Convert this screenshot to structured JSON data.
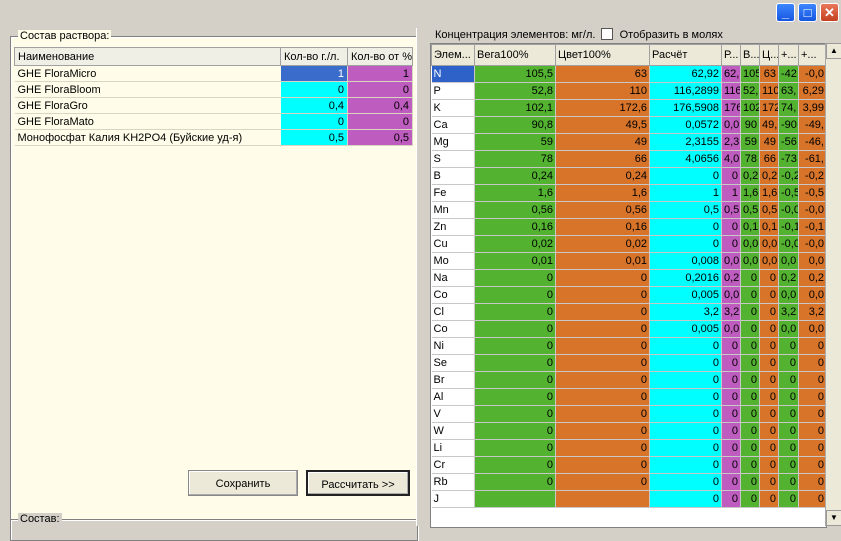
{
  "window": {
    "buttons": {
      "minimize": "_",
      "maximize": "□",
      "close": "✕"
    }
  },
  "left": {
    "group_title": "Состав раствора:",
    "bottom_group_title": "Состав:",
    "columns": [
      "Наименование",
      "Кол-во г./л.",
      "Кол-во от %"
    ],
    "rows": [
      {
        "name": "GHE FloraMicro",
        "qty": "1",
        "pct": "1"
      },
      {
        "name": "GHE FloraBloom",
        "qty": "0",
        "pct": "0"
      },
      {
        "name": "GHE FloraGro",
        "qty": "0,4",
        "pct": "0,4"
      },
      {
        "name": "GHE FloraMato",
        "qty": "0",
        "pct": "0"
      },
      {
        "name": "Монофосфат Калия KH2PO4 (Буйские уд-я)",
        "qty": "0,5",
        "pct": "0,5"
      }
    ],
    "save_label": "Сохранить",
    "calc_label": "Рассчитать >>"
  },
  "right": {
    "label": "Концентрация элементов: мг/л.",
    "checkbox_label": "Отобразить в молях",
    "columns": [
      "Элем...",
      "Вега100%",
      "Цвет100%",
      "Расчёт",
      "Р...",
      "В...",
      "Ц...",
      "+...",
      "+..."
    ],
    "rows": [
      [
        "N",
        "105,5",
        "63",
        "62,92",
        "62,",
        "105",
        "63",
        "-42",
        "-0,0"
      ],
      [
        "P",
        "52,8",
        "110",
        "116,2899",
        "116",
        "52,",
        "110",
        "63,",
        "6,29"
      ],
      [
        "K",
        "102,1",
        "172,6",
        "176,5908",
        "176",
        "102",
        "172",
        "74,",
        "3,99"
      ],
      [
        "Ca",
        "90,8",
        "49,5",
        "0,0572",
        "0,0",
        "90",
        "49,",
        "-90",
        "-49,"
      ],
      [
        "Mg",
        "59",
        "49",
        "2,3155",
        "2,3",
        "59",
        "49",
        "-56",
        "-46,"
      ],
      [
        "S",
        "78",
        "66",
        "4,0656",
        "4,0",
        "78",
        "66",
        "-73",
        "-61,"
      ],
      [
        "B",
        "0,24",
        "0,24",
        "0",
        "0",
        "0,2",
        "0,2",
        "-0,2",
        "-0,2"
      ],
      [
        "Fe",
        "1,6",
        "1,6",
        "1",
        "1",
        "1,6",
        "1,6",
        "-0,5",
        "-0,5"
      ],
      [
        "Mn",
        "0,56",
        "0,56",
        "0,5",
        "0,5",
        "0,5",
        "0,5",
        "-0,0",
        "-0,0"
      ],
      [
        "Zn",
        "0,16",
        "0,16",
        "0",
        "0",
        "0,1",
        "0,1",
        "-0,1",
        "-0,1"
      ],
      [
        "Cu",
        "0,02",
        "0,02",
        "0",
        "0",
        "0,0",
        "0,0",
        "-0,0",
        "-0,0"
      ],
      [
        "Mo",
        "0,01",
        "0,01",
        "0,008",
        "0,0",
        "0,0",
        "0,0",
        "0,0",
        "0,0"
      ],
      [
        "Na",
        "0",
        "0",
        "0,2016",
        "0,2",
        "0",
        "0",
        "0,2",
        "0,2"
      ],
      [
        "Co",
        "0",
        "0",
        "0,005",
        "0,0",
        "0",
        "0",
        "0,0",
        "0,0"
      ],
      [
        "Cl",
        "0",
        "0",
        "3,2",
        "3,2",
        "0",
        "0",
        "3,2",
        "3,2"
      ],
      [
        "Co",
        "0",
        "0",
        "0,005",
        "0,0",
        "0",
        "0",
        "0,0",
        "0,0"
      ],
      [
        "Ni",
        "0",
        "0",
        "0",
        "0",
        "0",
        "0",
        "0",
        "0"
      ],
      [
        "Se",
        "0",
        "0",
        "0",
        "0",
        "0",
        "0",
        "0",
        "0"
      ],
      [
        "Br",
        "0",
        "0",
        "0",
        "0",
        "0",
        "0",
        "0",
        "0"
      ],
      [
        "Al",
        "0",
        "0",
        "0",
        "0",
        "0",
        "0",
        "0",
        "0"
      ],
      [
        "V",
        "0",
        "0",
        "0",
        "0",
        "0",
        "0",
        "0",
        "0"
      ],
      [
        "W",
        "0",
        "0",
        "0",
        "0",
        "0",
        "0",
        "0",
        "0"
      ],
      [
        "Li",
        "0",
        "0",
        "0",
        "0",
        "0",
        "0",
        "0",
        "0"
      ],
      [
        "Cr",
        "0",
        "0",
        "0",
        "0",
        "0",
        "0",
        "0",
        "0"
      ],
      [
        "Rb",
        "0",
        "0",
        "0",
        "0",
        "0",
        "0",
        "0",
        "0"
      ],
      [
        "J",
        "",
        "",
        "0",
        "0",
        "0",
        "0",
        "0",
        "0"
      ]
    ],
    "scroll_up": "▲",
    "scroll_down": "▼"
  },
  "colors": {
    "green": "#53b331",
    "orange": "#d8742a",
    "cyan": "#00ffff",
    "magenta": "#bf5cbf",
    "selection": "#2f62c9"
  }
}
